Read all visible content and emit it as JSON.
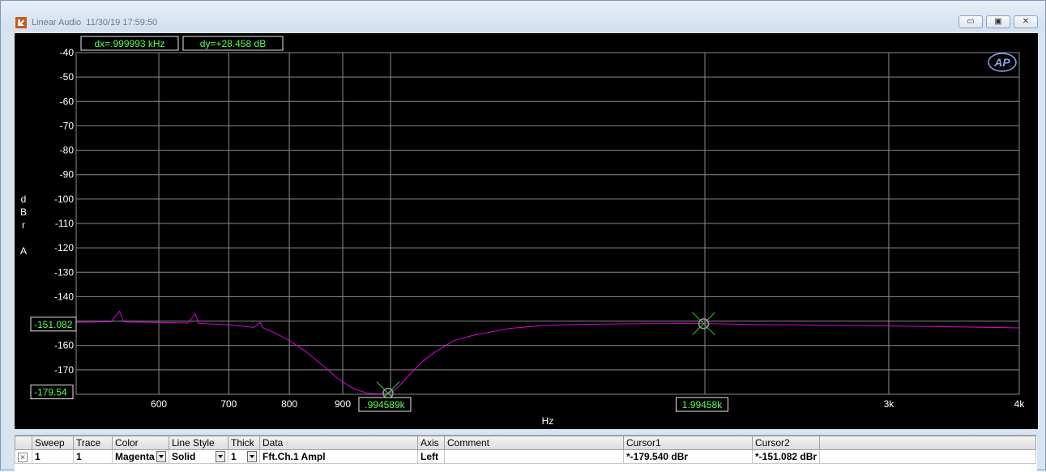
{
  "window": {
    "title": "Linear Audio",
    "timestamp": "11/30/19 17:59:50",
    "btn_minimize": "▭",
    "btn_maximize": "▣",
    "btn_close": "✕"
  },
  "readouts": {
    "dx": "dx=.999993 kHz",
    "dy": "dy=+28.458  dB"
  },
  "logo": "AP",
  "colors": {
    "trace": "#e000e0",
    "readout_text": "#55ff55",
    "grid": "#8a8a8a",
    "background": "#000000"
  },
  "cursor_labels": {
    "cursor1_x": ".994589k",
    "cursor2_x": "1.99458k",
    "cursor1_y": "-179.54",
    "cursor2_y": "-151.082"
  },
  "chart_data": {
    "type": "line",
    "xlabel": "Hz",
    "ylabel": "dBr A",
    "ylabel_chars": [
      "d",
      "B",
      "r",
      "",
      "A"
    ],
    "x_scale": "log",
    "xlim": [
      500,
      4000
    ],
    "ylim": [
      -180,
      -40
    ],
    "x_ticks": [
      {
        "v": 600,
        "label": "600"
      },
      {
        "v": 700,
        "label": "700"
      },
      {
        "v": 800,
        "label": "800"
      },
      {
        "v": 900,
        "label": "900"
      },
      {
        "v": 1000,
        "label": ""
      },
      {
        "v": 2000,
        "label": ""
      },
      {
        "v": 3000,
        "label": "3k"
      },
      {
        "v": 4000,
        "label": "4k"
      }
    ],
    "y_ticks": [
      -40,
      -50,
      -60,
      -70,
      -80,
      -90,
      -100,
      -110,
      -120,
      -130,
      -140,
      -150,
      -160,
      -170,
      -180
    ],
    "y_tick_labels": [
      "-40",
      "-50",
      "-60",
      "-70",
      "-80",
      "-90",
      "-100",
      "-110",
      "-120",
      "-130",
      "-140",
      "",
      "-160",
      "-170",
      "-180"
    ],
    "series": [
      {
        "name": "Fft.Ch.1 Ampl",
        "x": [
          500,
          540,
          550,
          555,
          560,
          600,
          640,
          650,
          655,
          660,
          700,
          740,
          750,
          755,
          760,
          780,
          800,
          830,
          860,
          890,
          920,
          950,
          970,
          985,
          995,
          1005,
          1020,
          1040,
          1070,
          1100,
          1150,
          1200,
          1300,
          1400,
          1500,
          1700,
          1900,
          2000,
          2200,
          2500,
          3000,
          3500,
          4000
        ],
        "y": [
          -150.5,
          -150.3,
          -146,
          -150.2,
          -150.4,
          -150.6,
          -150.8,
          -147,
          -150.9,
          -151.0,
          -151.5,
          -152.6,
          -150.5,
          -152.8,
          -153.2,
          -155.5,
          -158.0,
          -162.5,
          -168.0,
          -173.5,
          -177.5,
          -179.6,
          -179.8,
          -179.7,
          -179.5,
          -178.8,
          -176.5,
          -172.5,
          -167.0,
          -163.0,
          -158.0,
          -155.8,
          -153.0,
          -151.8,
          -151.4,
          -151.1,
          -151.0,
          -151.0,
          -151.4,
          -151.6,
          -152.0,
          -152.4,
          -152.8
        ]
      }
    ],
    "cursors": [
      {
        "x": 994.589,
        "y": -179.54
      },
      {
        "x": 1994.58,
        "y": -151.082
      }
    ]
  },
  "table": {
    "headers": [
      "Sweep",
      "Trace",
      "Color",
      "Line Style",
      "Thick",
      "Data",
      "Axis",
      "Comment",
      "Cursor1",
      "Cursor2"
    ],
    "row": {
      "sweep": "1",
      "trace": "1",
      "color": "Magenta",
      "line_style": "Solid",
      "thick": "1",
      "data": "Fft.Ch.1 Ampl",
      "axis": "Left",
      "comment": "",
      "cursor1": "*-179.540 dBr",
      "cursor2": "*-151.082 dBr"
    }
  }
}
